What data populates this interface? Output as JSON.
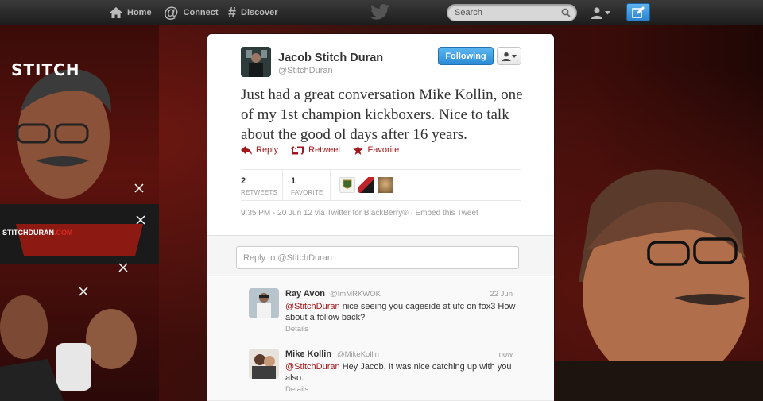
{
  "topbar": {
    "home_label": "Home",
    "connect_label": "Connect",
    "discover_label": "Discover",
    "search_placeholder": "Search",
    "logo_icon": "twitter-bird-icon",
    "compose_icon": "compose-tweet-icon"
  },
  "background": {
    "logo_text": "STITCH",
    "site_prefix": "STITCHDURAN",
    "site_suffix": ".COM"
  },
  "tweet": {
    "author_name": "Jacob Stitch Duran",
    "author_handle": "@StitchDuran",
    "follow_label": "Following",
    "text": "Just had a great conversation Mike Kollin, one of my 1st champion kickboxers. Nice to talk about the good ol days after 16 years.",
    "actions": {
      "reply": "Reply",
      "retweet": "Retweet",
      "favorite": "Favorite"
    },
    "retweets_count": "2",
    "retweets_label": "RETWEETS",
    "favorites_count": "1",
    "favorites_label": "FAVORITE",
    "timestamp": "9:35 PM - 20 Jun 12 via Twitter for BlackBerry® · Embed this Tweet"
  },
  "reply_box": {
    "placeholder": "Reply to @StitchDuran"
  },
  "replies": [
    {
      "name": "Ray Avon",
      "handle": "@ImMRKWOK",
      "time": "22 Jun",
      "mention": "@StitchDuran",
      "text": " nice seeing you cageside at ufc on fox3 How about a follow back?",
      "details": "Details"
    },
    {
      "name": "Mike Kollin",
      "handle": "@MikeKollin",
      "time": "now",
      "mention": "@StitchDuran",
      "text": " Hey Jacob, It was nice catching up with you also.",
      "details": "Details"
    }
  ],
  "colors": {
    "accent_red": "#a3171c",
    "follow_blue": "#2a8ad4",
    "background_red": "#5c120d"
  }
}
